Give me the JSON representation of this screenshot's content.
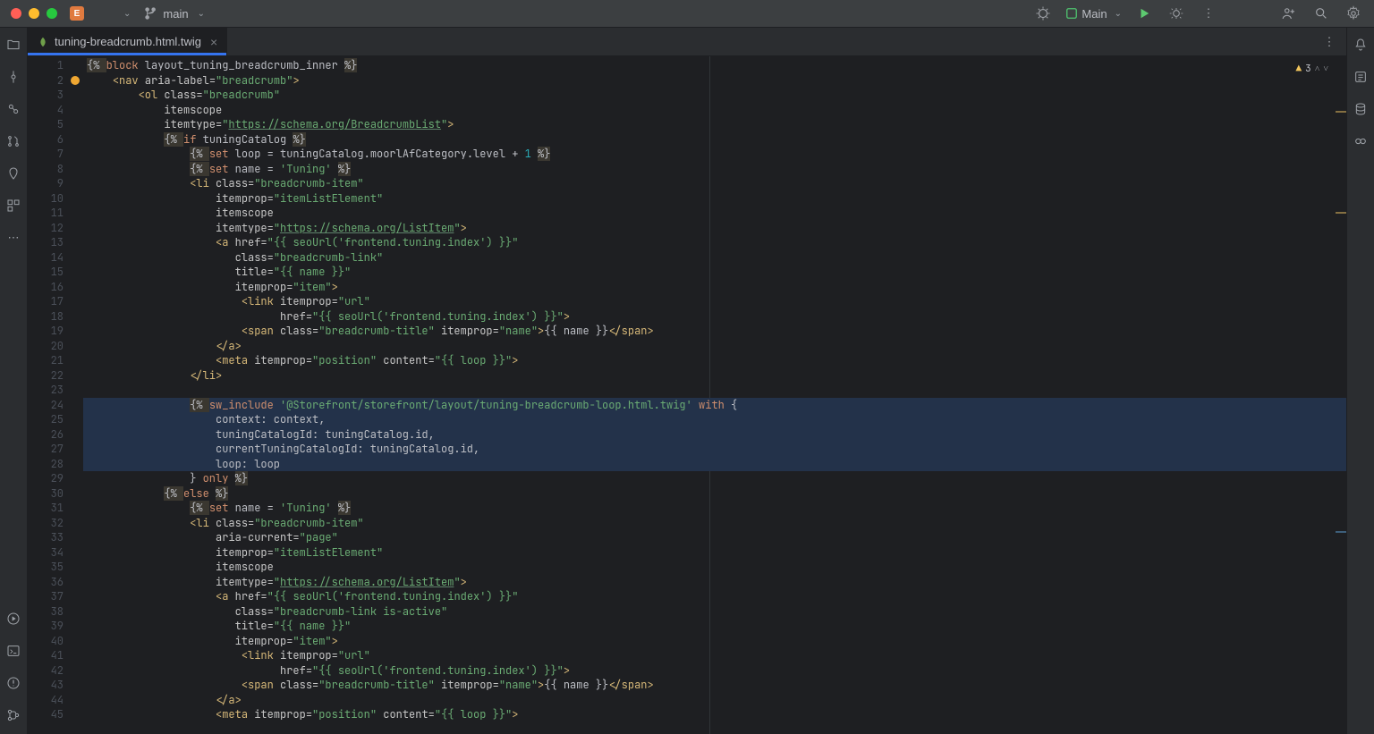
{
  "titlebar": {
    "project_badge": "E",
    "branch": "main",
    "run_config": "Main",
    "warnings_count": "3"
  },
  "tab": {
    "label": "tuning-breadcrumb.html.twig"
  },
  "gutter_lines": [
    "1",
    "2",
    "3",
    "4",
    "5",
    "6",
    "7",
    "8",
    "9",
    "10",
    "11",
    "12",
    "13",
    "14",
    "15",
    "16",
    "17",
    "18",
    "19",
    "20",
    "21",
    "22",
    "23",
    "24",
    "25",
    "26",
    "27",
    "28",
    "29",
    "30",
    "31",
    "32",
    "33",
    "34",
    "35",
    "36",
    "37",
    "38",
    "39",
    "40",
    "41",
    "42",
    "43",
    "44",
    "45"
  ],
  "code_lines": [
    {
      "n": 1,
      "hl": false,
      "tokens": [
        [
          "delim",
          "{% "
        ],
        [
          "kw",
          "block"
        ],
        [
          "plain",
          " layout_tuning_breadcrumb_inner "
        ],
        [
          "delim",
          "%}"
        ]
      ]
    },
    {
      "n": 2,
      "bulb": true,
      "tokens": [
        [
          "plain",
          "    "
        ],
        [
          "tag",
          "<nav "
        ],
        [
          "attr",
          "aria-label="
        ],
        [
          "str",
          "\"breadcrumb\""
        ],
        [
          "tag",
          ">"
        ]
      ]
    },
    {
      "n": 3,
      "tokens": [
        [
          "plain",
          "        "
        ],
        [
          "tag",
          "<ol "
        ],
        [
          "attr",
          "class="
        ],
        [
          "str",
          "\"breadcrumb\""
        ]
      ]
    },
    {
      "n": 4,
      "tokens": [
        [
          "plain",
          "            "
        ],
        [
          "attr",
          "itemscope"
        ]
      ]
    },
    {
      "n": 5,
      "tokens": [
        [
          "plain",
          "            "
        ],
        [
          "attr",
          "itemtype="
        ],
        [
          "str",
          "\""
        ],
        [
          "str-u",
          "https://schema.org/BreadcrumbList"
        ],
        [
          "str",
          "\""
        ],
        [
          "tag",
          ">"
        ]
      ]
    },
    {
      "n": 6,
      "tokens": [
        [
          "plain",
          "            "
        ],
        [
          "delim",
          "{% "
        ],
        [
          "kw",
          "if"
        ],
        [
          "plain",
          " tuningCatalog "
        ],
        [
          "delim",
          "%}"
        ]
      ]
    },
    {
      "n": 7,
      "tokens": [
        [
          "plain",
          "                "
        ],
        [
          "delim",
          "{% "
        ],
        [
          "kw",
          "set"
        ],
        [
          "plain",
          " loop = tuningCatalog.moorlAfCategory.level + "
        ],
        [
          "num",
          "1"
        ],
        [
          "plain",
          " "
        ],
        [
          "delim",
          "%}"
        ]
      ]
    },
    {
      "n": 8,
      "tokens": [
        [
          "plain",
          "                "
        ],
        [
          "delim",
          "{% "
        ],
        [
          "kw",
          "set"
        ],
        [
          "plain",
          " name = "
        ],
        [
          "str",
          "'Tuning'"
        ],
        [
          "plain",
          " "
        ],
        [
          "delim",
          "%}"
        ]
      ]
    },
    {
      "n": 9,
      "tokens": [
        [
          "plain",
          "                "
        ],
        [
          "tag",
          "<li "
        ],
        [
          "attr",
          "class="
        ],
        [
          "str",
          "\"breadcrumb-item\""
        ]
      ]
    },
    {
      "n": 10,
      "tokens": [
        [
          "plain",
          "                    "
        ],
        [
          "attr",
          "itemprop="
        ],
        [
          "str",
          "\"itemListElement\""
        ]
      ]
    },
    {
      "n": 11,
      "tokens": [
        [
          "plain",
          "                    "
        ],
        [
          "attr",
          "itemscope"
        ]
      ]
    },
    {
      "n": 12,
      "tokens": [
        [
          "plain",
          "                    "
        ],
        [
          "attr",
          "itemtype="
        ],
        [
          "str",
          "\""
        ],
        [
          "str-u",
          "https://schema.org/ListItem"
        ],
        [
          "str",
          "\""
        ],
        [
          "tag",
          ">"
        ]
      ]
    },
    {
      "n": 13,
      "tokens": [
        [
          "plain",
          "                    "
        ],
        [
          "tag",
          "<a "
        ],
        [
          "attr",
          "href="
        ],
        [
          "str",
          "\"{{ seoUrl("
        ],
        [
          "str2",
          "'frontend.tuning.index'"
        ],
        [
          "str",
          ") }}\""
        ]
      ]
    },
    {
      "n": 14,
      "tokens": [
        [
          "plain",
          "                       "
        ],
        [
          "attr",
          "class="
        ],
        [
          "str",
          "\"breadcrumb-link\""
        ]
      ]
    },
    {
      "n": 15,
      "tokens": [
        [
          "plain",
          "                       "
        ],
        [
          "attr",
          "title="
        ],
        [
          "str",
          "\"{{ name }}\""
        ]
      ]
    },
    {
      "n": 16,
      "tokens": [
        [
          "plain",
          "                       "
        ],
        [
          "attr",
          "itemprop="
        ],
        [
          "str",
          "\"item\""
        ],
        [
          "tag",
          ">"
        ]
      ]
    },
    {
      "n": 17,
      "tokens": [
        [
          "plain",
          "                        "
        ],
        [
          "tag",
          "<link "
        ],
        [
          "attr",
          "itemprop="
        ],
        [
          "str",
          "\"url\""
        ]
      ]
    },
    {
      "n": 18,
      "tokens": [
        [
          "plain",
          "                              "
        ],
        [
          "attr",
          "href="
        ],
        [
          "str",
          "\"{{ seoUrl("
        ],
        [
          "str2",
          "'frontend.tuning.index'"
        ],
        [
          "str",
          ") }}\""
        ],
        [
          "tag",
          ">"
        ]
      ]
    },
    {
      "n": 19,
      "tokens": [
        [
          "plain",
          "                        "
        ],
        [
          "tag",
          "<span "
        ],
        [
          "attr",
          "class="
        ],
        [
          "str",
          "\"breadcrumb-title\""
        ],
        [
          "plain",
          " "
        ],
        [
          "attr",
          "itemprop="
        ],
        [
          "str",
          "\"name\""
        ],
        [
          "tag",
          ">"
        ],
        [
          "plain",
          "{{ name }}"
        ],
        [
          "tag",
          "</span>"
        ]
      ]
    },
    {
      "n": 20,
      "tokens": [
        [
          "plain",
          "                    "
        ],
        [
          "tag",
          "</a>"
        ]
      ]
    },
    {
      "n": 21,
      "tokens": [
        [
          "plain",
          "                    "
        ],
        [
          "tag",
          "<meta "
        ],
        [
          "attr",
          "itemprop="
        ],
        [
          "str",
          "\"position\""
        ],
        [
          "plain",
          " "
        ],
        [
          "attr",
          "content="
        ],
        [
          "str",
          "\"{{ loop }}\""
        ],
        [
          "tag",
          ">"
        ]
      ]
    },
    {
      "n": 22,
      "tokens": [
        [
          "plain",
          "                "
        ],
        [
          "tag",
          "</li>"
        ]
      ]
    },
    {
      "n": 23,
      "tokens": [
        [
          "plain",
          ""
        ]
      ]
    },
    {
      "n": 24,
      "sel": true,
      "tokens": [
        [
          "plain",
          "                "
        ],
        [
          "delim",
          "{% "
        ],
        [
          "kw",
          "sw_include"
        ],
        [
          "plain",
          " "
        ],
        [
          "str",
          "'@Storefront/storefront/layout/tuning-breadcrumb-loop.html.twig'"
        ],
        [
          "plain",
          " "
        ],
        [
          "kw",
          "with"
        ],
        [
          "plain",
          " {"
        ]
      ]
    },
    {
      "n": 25,
      "sel": true,
      "tokens": [
        [
          "plain",
          "                    context: context,"
        ]
      ]
    },
    {
      "n": 26,
      "sel": true,
      "tokens": [
        [
          "plain",
          "                    tuningCatalogId: tuningCatalog.id,"
        ]
      ]
    },
    {
      "n": 27,
      "sel": true,
      "tokens": [
        [
          "plain",
          "                    currentTuningCatalogId: tuningCatalog.id,"
        ]
      ]
    },
    {
      "n": 28,
      "sel": true,
      "tokens": [
        [
          "plain",
          "                    loop: loop"
        ]
      ]
    },
    {
      "n": 29,
      "tokens": [
        [
          "plain",
          "                } "
        ],
        [
          "kw",
          "only"
        ],
        [
          "plain",
          " "
        ],
        [
          "delim",
          "%}"
        ]
      ]
    },
    {
      "n": 30,
      "tokens": [
        [
          "plain",
          "            "
        ],
        [
          "delim",
          "{% "
        ],
        [
          "kw",
          "else"
        ],
        [
          "plain",
          " "
        ],
        [
          "delim",
          "%}"
        ]
      ]
    },
    {
      "n": 31,
      "tokens": [
        [
          "plain",
          "                "
        ],
        [
          "delim",
          "{% "
        ],
        [
          "kw",
          "set"
        ],
        [
          "plain",
          " name = "
        ],
        [
          "str",
          "'Tuning'"
        ],
        [
          "plain",
          " "
        ],
        [
          "delim",
          "%}"
        ]
      ]
    },
    {
      "n": 32,
      "tokens": [
        [
          "plain",
          "                "
        ],
        [
          "tag",
          "<li "
        ],
        [
          "attr",
          "class="
        ],
        [
          "str",
          "\"breadcrumb-item\""
        ]
      ]
    },
    {
      "n": 33,
      "tokens": [
        [
          "plain",
          "                    "
        ],
        [
          "attr",
          "aria-current="
        ],
        [
          "str",
          "\"page\""
        ]
      ]
    },
    {
      "n": 34,
      "tokens": [
        [
          "plain",
          "                    "
        ],
        [
          "attr",
          "itemprop="
        ],
        [
          "str",
          "\"itemListElement\""
        ]
      ]
    },
    {
      "n": 35,
      "tokens": [
        [
          "plain",
          "                    "
        ],
        [
          "attr",
          "itemscope"
        ]
      ]
    },
    {
      "n": 36,
      "tokens": [
        [
          "plain",
          "                    "
        ],
        [
          "attr",
          "itemtype="
        ],
        [
          "str",
          "\""
        ],
        [
          "str-u",
          "https://schema.org/ListItem"
        ],
        [
          "str",
          "\""
        ],
        [
          "tag",
          ">"
        ]
      ]
    },
    {
      "n": 37,
      "tokens": [
        [
          "plain",
          "                    "
        ],
        [
          "tag",
          "<a "
        ],
        [
          "attr",
          "href="
        ],
        [
          "str",
          "\"{{ seoUrl("
        ],
        [
          "str2",
          "'frontend.tuning.index'"
        ],
        [
          "str",
          ") }}\""
        ]
      ]
    },
    {
      "n": 38,
      "tokens": [
        [
          "plain",
          "                       "
        ],
        [
          "attr",
          "class="
        ],
        [
          "str",
          "\"breadcrumb-link is-active\""
        ]
      ]
    },
    {
      "n": 39,
      "tokens": [
        [
          "plain",
          "                       "
        ],
        [
          "attr",
          "title="
        ],
        [
          "str",
          "\"{{ name }}\""
        ]
      ]
    },
    {
      "n": 40,
      "tokens": [
        [
          "plain",
          "                       "
        ],
        [
          "attr",
          "itemprop="
        ],
        [
          "str",
          "\"item\""
        ],
        [
          "tag",
          ">"
        ]
      ]
    },
    {
      "n": 41,
      "tokens": [
        [
          "plain",
          "                        "
        ],
        [
          "tag",
          "<link "
        ],
        [
          "attr",
          "itemprop="
        ],
        [
          "str",
          "\"url\""
        ]
      ]
    },
    {
      "n": 42,
      "tokens": [
        [
          "plain",
          "                              "
        ],
        [
          "attr",
          "href="
        ],
        [
          "str",
          "\"{{ seoUrl("
        ],
        [
          "str2",
          "'frontend.tuning.index'"
        ],
        [
          "str",
          ") }}\""
        ],
        [
          "tag",
          ">"
        ]
      ]
    },
    {
      "n": 43,
      "tokens": [
        [
          "plain",
          "                        "
        ],
        [
          "tag",
          "<span "
        ],
        [
          "attr",
          "class="
        ],
        [
          "str",
          "\"breadcrumb-title\""
        ],
        [
          "plain",
          " "
        ],
        [
          "attr",
          "itemprop="
        ],
        [
          "str",
          "\"name\""
        ],
        [
          "tag",
          ">"
        ],
        [
          "plain",
          "{{ name }}"
        ],
        [
          "tag",
          "</span>"
        ]
      ]
    },
    {
      "n": 44,
      "tokens": [
        [
          "plain",
          "                    "
        ],
        [
          "tag",
          "</a>"
        ]
      ]
    },
    {
      "n": 45,
      "tokens": [
        [
          "plain",
          "                    "
        ],
        [
          "tag",
          "<meta "
        ],
        [
          "attr",
          "itemprop="
        ],
        [
          "str",
          "\"position\""
        ],
        [
          "plain",
          " "
        ],
        [
          "attr",
          "content="
        ],
        [
          "str",
          "\"{{ loop }}\""
        ],
        [
          "tag",
          ">"
        ]
      ]
    }
  ]
}
